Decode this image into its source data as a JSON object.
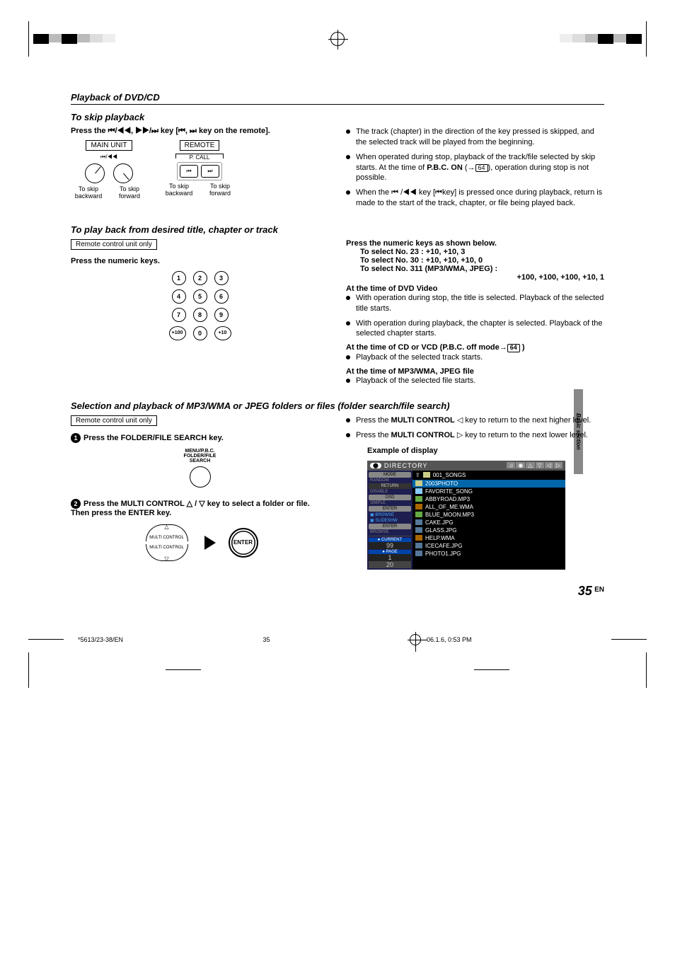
{
  "header": {
    "section": "Playback of DVD/CD"
  },
  "skip": {
    "title": "To skip playback",
    "instruction_pre": "Press the ",
    "instruction_keys1": "⏮/◀◀, ▶▶/⏭",
    "instruction_mid": " key [",
    "instruction_keys2": "⏮, ⏭",
    "instruction_post": " key on the remote].",
    "main_unit": "MAIN UNIT",
    "remote": "REMOTE",
    "pcall": "P. CALL",
    "skip_back": "To skip backward",
    "skip_fwd": "To skip forward",
    "knob_left_glyph": "⏮/◀◀",
    "knob_right_glyph": "▶▶/⏭",
    "rbtn_prev": "⏮",
    "rbtn_next": "⏭",
    "bullets": [
      "The track (chapter) in the direction of the key pressed is skipped, and the selected track will be played from the beginning.",
      "When operated during stop, playback of the track/file selected by skip starts. At the time of P.B.C. ON (→64), operation during stop is not possible.",
      "When the ⏮ /◀◀ key [⏮key] is pressed once during playback, return is made to the start of the track, chapter, or file being played back."
    ]
  },
  "playback_title": {
    "title": "To play back from desired title, chapter or track",
    "remote_only": "Remote control unit only",
    "press_numeric": "Press the numeric keys.",
    "keys": [
      [
        "1",
        "2",
        "3"
      ],
      [
        "4",
        "5",
        "6"
      ],
      [
        "7",
        "8",
        "9"
      ],
      [
        "+100",
        "0",
        "+10"
      ]
    ],
    "right_heading": "Press the numeric keys as shown below.",
    "sel23": "To select No. 23 : +10, +10, 3",
    "sel30": "To select No. 30 : +10, +10, +10, 0",
    "sel311a": "To select No. 311 (MP3/WMA, JPEG) :",
    "sel311b": "+100, +100, +100, +10, 1",
    "dvd_heading": "At the time of DVD Video",
    "dvd_b1": "With operation during stop, the title is selected. Playback of the selected title starts.",
    "dvd_b2": "With operation during playback, the chapter is selected. Playback of the selected chapter starts.",
    "cd_heading": "At the time of CD or VCD (P.B.C. off mode→64 )",
    "cd_b1": "Playback of the selected track starts.",
    "mp3_heading": "At the time of MP3/WMA, JPEG file",
    "mp3_b1": "Playback of the selected file starts."
  },
  "folder": {
    "title": "Selection and playback of MP3/WMA or JPEG folders or files (folder search/file search)",
    "remote_only": "Remote control unit only",
    "step1": "Press the FOLDER/FILE SEARCH key.",
    "search_label": "MENU/P.B.C.\nFOLDER/FILE\nSEARCH",
    "step2": "Press the MULTI CONTROL △ / ▽ key to select a folder or file.  Then press the ENTER key.",
    "multi_label": "MULTI CONTROL",
    "enter_label": "ENTER",
    "right_b1": "Press the MULTI CONTROL ◁ key to return to the next higher level.",
    "right_b2": "Press the MULTI CONTROL ▷ key to return to the next lower level.",
    "example_heading": "Example of display",
    "de_dir": "DIRECTORY",
    "de_top": "001_SONGS",
    "side": {
      "mode": "MODE",
      "random": "RANDOM",
      "return": "RETURN",
      "disable": "DISABLE",
      "osd": "OSD",
      "simple": "SIMPLE",
      "enter": "ENTER",
      "browse": "BROWSE",
      "slideshw": "SLIDESHW",
      "current_lbl": "CURRENT",
      "current_val": "99",
      "page_lbl": "PAGE",
      "page_val": "1",
      "page_total": "20"
    },
    "rows": [
      {
        "cls": "hl",
        "icon": "ficon",
        "name": "2003PHOTO"
      },
      {
        "icon": "ficon up",
        "name": "FAVORITE_SONG"
      },
      {
        "icon": "ficon mp3",
        "name": "ABBYROAD.MP3"
      },
      {
        "icon": "ficon wma",
        "name": "ALL_OF_ME.WMA"
      },
      {
        "icon": "ficon mp3",
        "name": "BLUE_MOON.MP3"
      },
      {
        "icon": "ficon jpg",
        "name": "CAKE.JPG"
      },
      {
        "icon": "ficon jpg",
        "name": "GLASS.JPG"
      },
      {
        "icon": "ficon wma",
        "name": "HELP.WMA"
      },
      {
        "icon": "ficon jpg",
        "name": "ICECAFE.JPG"
      },
      {
        "icon": "ficon jpg",
        "name": "PHOTO1.JPG"
      }
    ]
  },
  "sidebar": "Basic section",
  "page": {
    "num": "35",
    "lang": "EN"
  },
  "footer": {
    "left": "*5613/23-38/EN",
    "mid": "35",
    "right": "06.1.6, 0:53 PM"
  }
}
